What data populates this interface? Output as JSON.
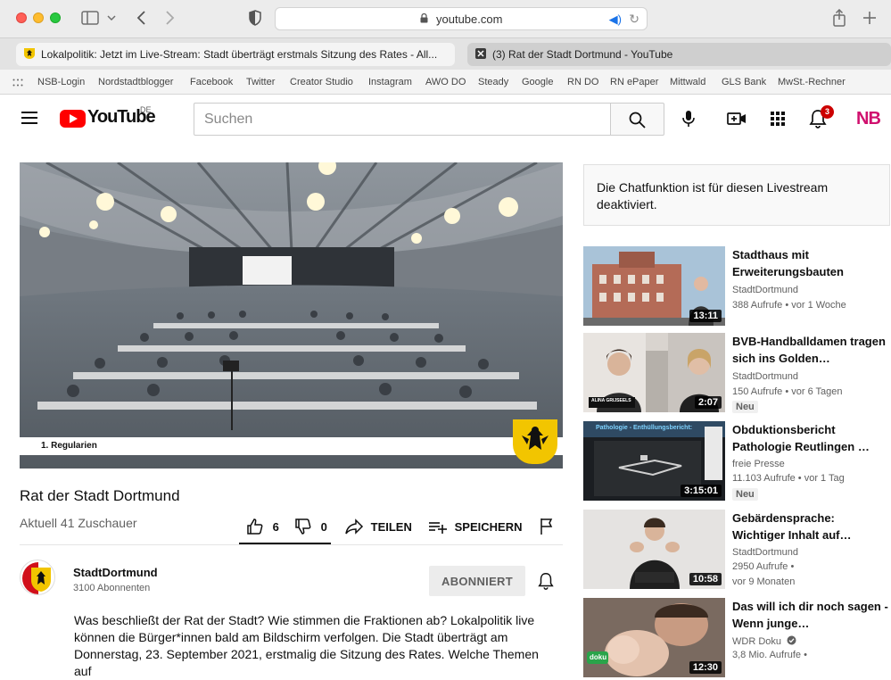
{
  "browser": {
    "url": "youtube.com",
    "tabs": [
      {
        "label": "Lokalpolitik: Jetzt im Live-Stream: Stadt überträgt erstmals Sitzung des Rates - All..."
      },
      {
        "label": "(3) Rat der Stadt Dortmund - YouTube"
      }
    ],
    "bookmarks": [
      "NSB-Login",
      "Nordstadtblogger",
      "Facebook",
      "Twitter",
      "Creator Studio",
      "Instagram",
      "AWO DO",
      "Steady",
      "Google",
      "RN DO",
      "RN ePaper",
      "Mittwald",
      "GLS Bank",
      "MwSt.-Rechner"
    ]
  },
  "header": {
    "logo_text": "YouTube",
    "country": "DE",
    "search_placeholder": "Suchen",
    "notification_count": "3",
    "account_initials": "NB"
  },
  "video": {
    "overlay_label": "1. Regularien",
    "title": "Rat der Stadt Dortmund",
    "viewers": "Aktuell 41 Zuschauer",
    "likes": "6",
    "dislikes": "0",
    "share_label": "TEILEN",
    "save_label": "SPEICHERN"
  },
  "channel": {
    "name": "StadtDortmund",
    "subscribers": "3100 Abonnenten",
    "subscribe_label": "ABONNIERT",
    "description": "Was beschließt der Rat der Stadt? Wie stimmen die Fraktionen ab? Lokalpolitik live können die Bürger*innen bald am Bildschirm verfolgen. Die Stadt überträgt am Donnerstag, 23. September 2021, erstmalig die Sitzung des Rates. Welche Themen auf"
  },
  "chat_notice": "Die Chatfunktion ist für diesen Livestream deaktiviert.",
  "recommendations": [
    {
      "title": "Stadthaus mit Erweiterungsbauten",
      "channel": "StadtDortmund",
      "meta": "388 Aufrufe • vor 1 Woche",
      "duration": "13:11",
      "badge": ""
    },
    {
      "title": "BVB-Handballdamen tragen sich ins Golden…",
      "channel": "StadtDortmund",
      "meta": "150 Aufrufe • vor 6 Tagen",
      "duration": "2:07",
      "badge": "Neu"
    },
    {
      "title": "Obduktionsbericht Pathologie Reutlingen …",
      "channel": "freie Presse",
      "meta": "11.103 Aufrufe • vor 1 Tag",
      "duration": "3:15:01",
      "badge": "Neu"
    },
    {
      "title": "Gebärdensprache: Wichtiger Inhalt auf…",
      "channel": "StadtDortmund",
      "meta": "2950 Aufrufe •",
      "meta2": "vor 9 Monaten",
      "duration": "10:58",
      "badge": ""
    },
    {
      "title": "Das will ich dir noch sagen - Wenn junge…",
      "channel": "WDR Doku",
      "meta": "3,8 Mio. Aufrufe •",
      "duration": "12:30",
      "badge": ""
    }
  ],
  "thumb_texts": {
    "bvb_caption": "ALINA GRIJSEELS",
    "patho_caption": "Pathologie - Enthüllungsbericht:",
    "doku_label": "doku"
  }
}
